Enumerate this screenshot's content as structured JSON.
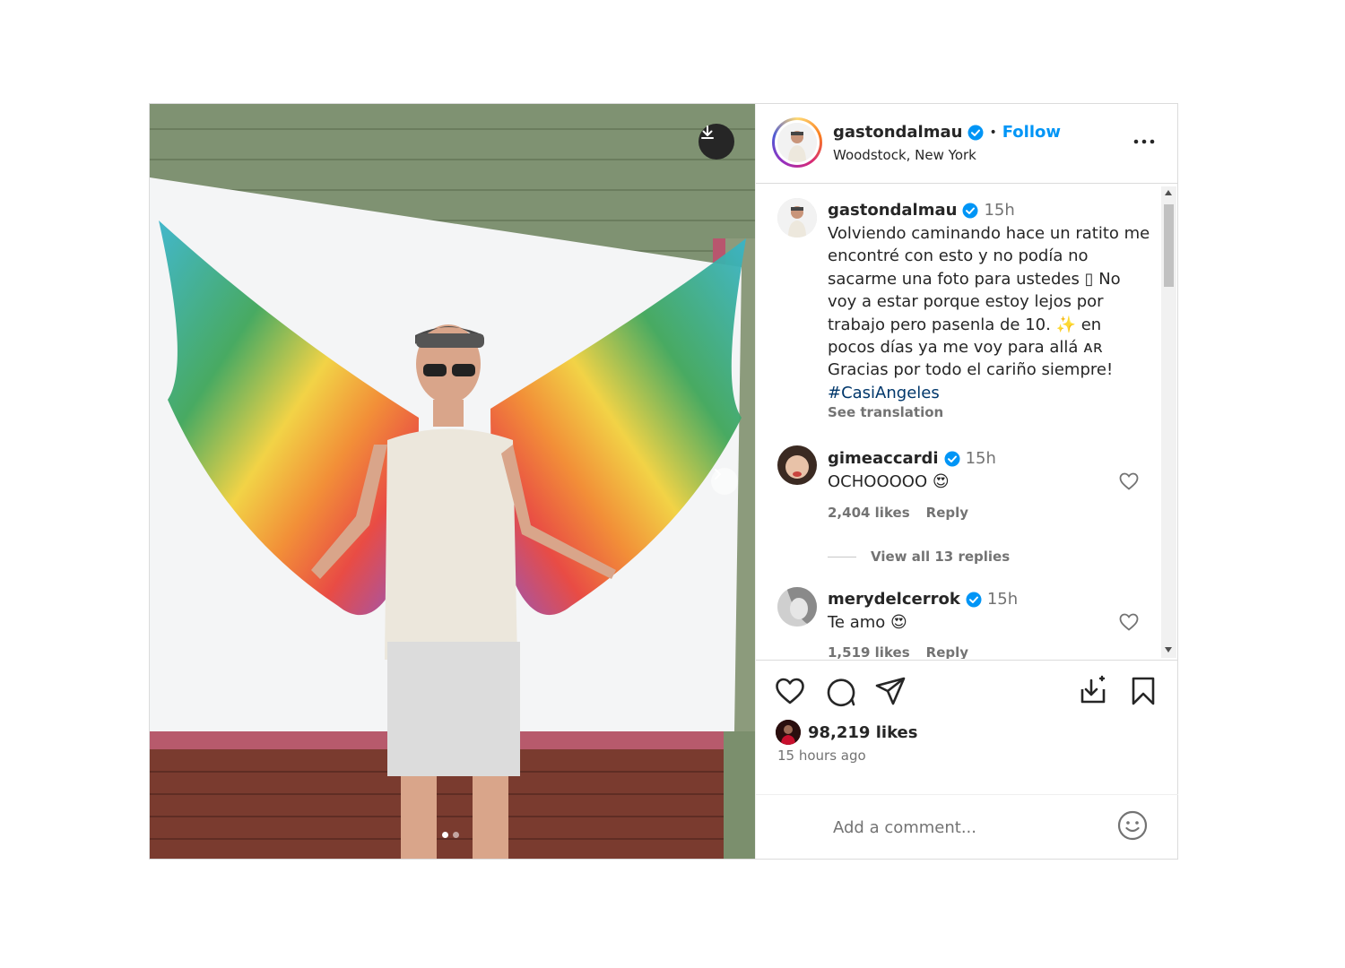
{
  "post": {
    "author": "gastondalmau",
    "follow_label": "Follow",
    "bullet": "•",
    "location": "Woodstock, New York",
    "image_dots": 2,
    "active_dot": 1
  },
  "caption": {
    "username": "gastondalmau",
    "time": "15h",
    "text": "Volviendo caminando hace un ratito me encontré con esto y no podía no sacarme una foto para ustedes ▯ No voy a estar porque estoy lejos por trabajo pero pasenla de 10. ✨ en pocos días ya me voy para allá ᴀʀ Gracias por todo el cariño siempre!",
    "hashtag": "#CasiAngeles",
    "see_translation": "See translation"
  },
  "comments": [
    {
      "username": "gimeaccardi",
      "time": "15h",
      "text": "OCHOOOOO 😍",
      "likes": "2,404 likes",
      "reply": "Reply"
    },
    {
      "username": "merydelcerrok",
      "time": "15h",
      "text": "Te amo 😍",
      "likes": "1,519 likes",
      "reply": "Reply"
    }
  ],
  "view_replies": "View all 13 replies",
  "stats": {
    "likes": "98,219 likes",
    "time_ago": "15 hours ago"
  },
  "add_comment": {
    "placeholder": "Add a comment..."
  },
  "colors": {
    "accent": "#0095f6",
    "verified": "#0095f6",
    "muted": "#737373",
    "hashtag": "#00376b"
  }
}
